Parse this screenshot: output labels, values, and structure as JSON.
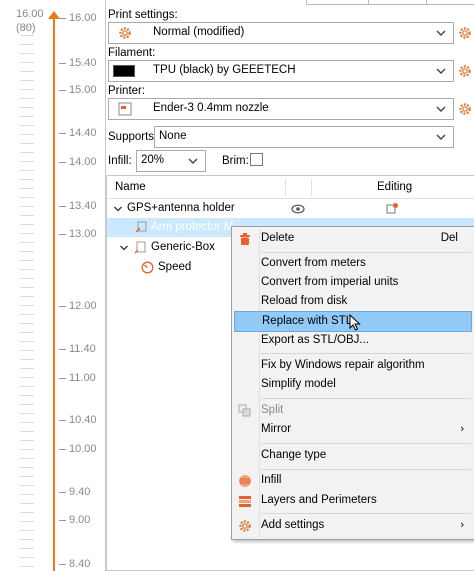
{
  "ruler": {
    "top_value": "16.00",
    "top_layer": "(80)",
    "ticks": [
      "16.00",
      "15.40",
      "15.00",
      "14.40",
      "14.00",
      "13.40",
      "13.00",
      "12.00",
      "11.40",
      "11.00",
      "10.40",
      "10.00",
      "9.40",
      "9.00",
      "8.40"
    ]
  },
  "print_settings": {
    "label": "Print settings:",
    "value": "Normal (modified)"
  },
  "filament": {
    "label": "Filament:",
    "value": "TPU (black) by GEEETECH",
    "color": "#000000"
  },
  "printer": {
    "label": "Printer:",
    "value": "Ender-3 0.4mm nozzle"
  },
  "supports": {
    "label": "Supports:",
    "value": "None"
  },
  "infill": {
    "label": "Infill:",
    "value": "20%"
  },
  "brim": {
    "label": "Brim:",
    "checked": false
  },
  "object_list": {
    "col_name": "Name",
    "col_editing": "Editing",
    "rows": {
      "object1": "GPS+antenna holder",
      "part1": "Arm protector M...",
      "object2": "Generic-Box",
      "setting": "Speed"
    }
  },
  "context_menu": {
    "delete": "Delete",
    "delete_shortcut": "Del",
    "convert_from_meters": "Convert from meters",
    "convert_from_imperial": "Convert from imperial units",
    "reload_from_disk": "Reload from disk",
    "replace_with_stl": "Replace with STL",
    "export_as_stl": "Export as STL/OBJ...",
    "fix_windows_repair": "Fix by Windows repair algorithm",
    "simplify_model": "Simplify model",
    "split": "Split",
    "mirror": "Mirror",
    "change_type": "Change type",
    "infill": "Infill",
    "layers_perimeters": "Layers and Perimeters",
    "add_settings": "Add settings"
  },
  "colors": {
    "accent": "#ee7a10",
    "selection": "#cce8ff",
    "menu_hover": "#91c9f7"
  }
}
